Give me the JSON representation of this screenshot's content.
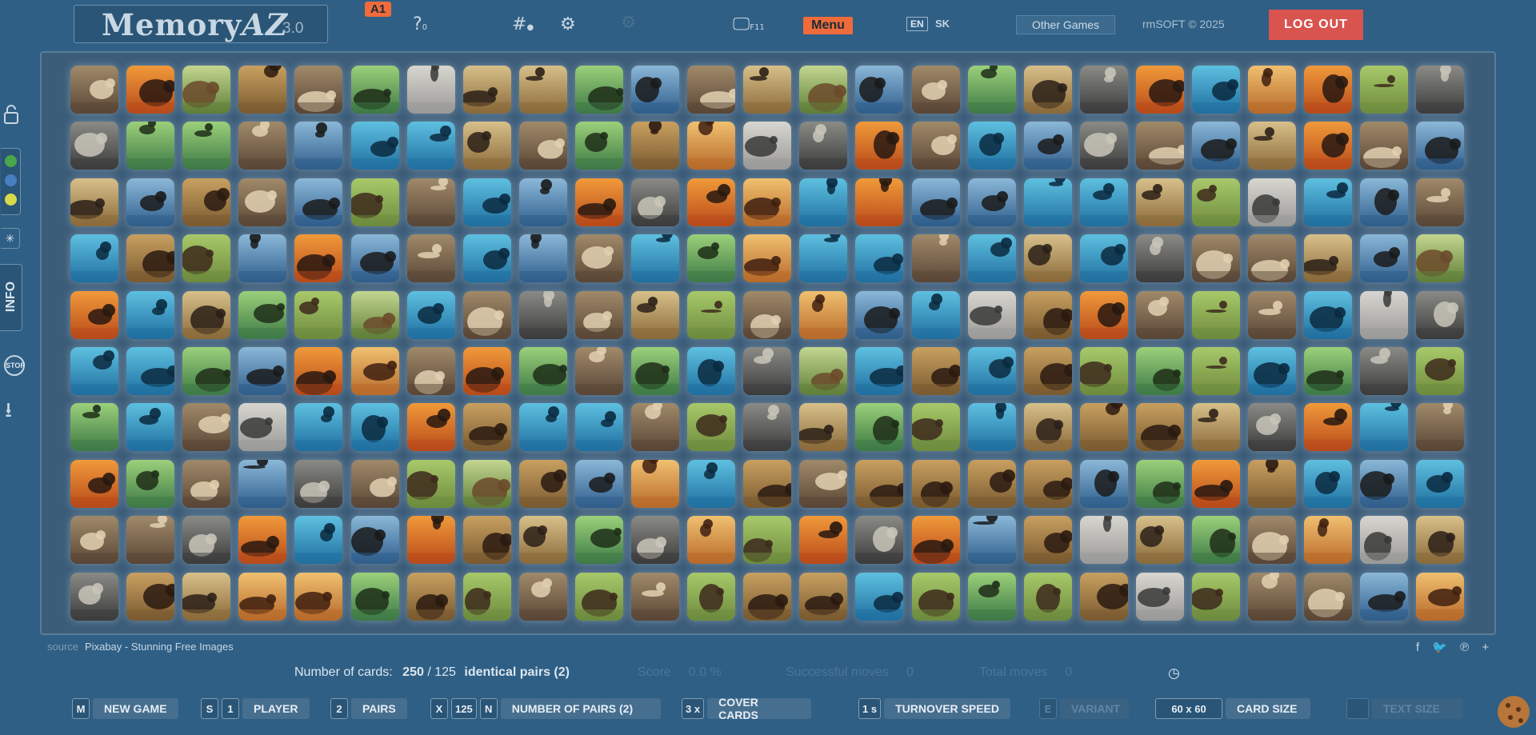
{
  "header": {
    "logo_name": "Memory",
    "logo_az": "AZ",
    "logo_version": "3.0",
    "level_badge": "A1",
    "help_icon": "?",
    "help_count": "0",
    "hash_icon": "#",
    "monitor_hint": "F11",
    "menu_label": "Menu",
    "lang_en": "EN",
    "lang_sk": "SK",
    "other_games": "Other Games",
    "copyright": "rmSOFT © 2025",
    "logout": "LOG OUT"
  },
  "sidebar": {
    "info_label": "INFO",
    "stop_label": "STOP",
    "colors": [
      "#4aa64a",
      "#4a7ec2",
      "#d8d84a"
    ]
  },
  "board": {
    "columns": 25,
    "rows": 10,
    "cards": [
      "shark",
      "orangutan",
      "butterfly",
      "cougar",
      "duck",
      "rooster",
      "peacock",
      "goose",
      "stag-beetle",
      "lion",
      "hamster",
      "tern",
      "stag-beetle",
      "lynx",
      "hamster",
      "lemur",
      "dragonfly",
      "porcupine",
      "meerkats",
      "orangutan",
      "camel",
      "iguana",
      "goat",
      "turtle",
      "salamander",
      "boar",
      "dragonfly",
      "pheasant",
      "elephant",
      "antelope",
      "peacock-butterfly",
      "parrot",
      "vulture",
      "emu",
      "snake",
      "hedgehog",
      "caterpillar",
      "chameleon",
      "chimpanzee",
      "goat",
      "shark",
      "skunk",
      "deer",
      "boar",
      "tern",
      "jellyfish",
      "squirrel",
      "yak",
      "duck",
      "cheetah",
      "snail",
      "deer",
      "crow",
      "leopard",
      "pig",
      "kangaroo",
      "clownfish",
      "peacock-butterfly",
      "antelope",
      "moose",
      "dolphin",
      "beetle",
      "macaw",
      "anteater",
      "polar-bear",
      "pig",
      "deer",
      "walrus",
      "rabbit",
      "angelfish",
      "spoonbill",
      "frog",
      "parrot",
      "ram",
      "cicada",
      "lizard",
      "mallard",
      "crab",
      "hornet",
      "tit",
      "jellyfish",
      "cicada",
      "camel",
      "hornet",
      "leopard",
      "walrus",
      "wildebeest",
      "horse",
      "walrus",
      "seahorse",
      "swallow",
      "hummingbird",
      "orca",
      "hippo",
      "chimpanzee",
      "mandrill",
      "duck",
      "goose",
      "deer",
      "butterfly",
      "fly",
      "pelican",
      "porcupine",
      "bear",
      "spoonbill",
      "fox",
      "gorilla",
      "mandrill",
      "salamander",
      "stingray",
      "angelfish",
      "turtle",
      "hen",
      "spider",
      "cheetah",
      "lemurs",
      "tapir",
      "hyena",
      "yak",
      "magpie",
      "turtle",
      "cicada",
      "grasshopper",
      "peacock",
      "panda",
      "hummingbird",
      "zebra",
      "lion",
      "hawks",
      "flamingo",
      "crane",
      "hen",
      "tit",
      "hare",
      "elephant",
      "guinea-pig",
      "koala",
      "pigeon",
      "fox",
      "zebra",
      "stork",
      "hippo",
      "mallard",
      "kangaroo",
      "dog",
      "turtle",
      "grasshopper",
      "rooster",
      "pigeon",
      "heron",
      "pheasant",
      "rabbit",
      "manatee",
      "chameleon",
      "turkey",
      "koala",
      "beetle",
      "sheep",
      "turkey",
      "pelican",
      "ladybugs",
      "heron",
      "meerkats",
      "goose",
      "owl",
      "fish",
      "anteater",
      "hawk",
      "cougar",
      "bison",
      "squirrel",
      "cat",
      "baboon",
      "walrus",
      "swallow",
      "fly",
      "snake",
      "stingray",
      "ostriches",
      "bats",
      "emu",
      "crab",
      "lynx",
      "crow",
      "deer",
      "caterpillar",
      "lemurs",
      "tiger",
      "manatee",
      "tiger",
      "cow",
      "crow",
      "stork",
      "ram",
      "dog",
      "moose",
      "hedgehog",
      "skunk",
      "wolf",
      "gorilla",
      "lemur",
      "clownfish",
      "dolphin",
      "moose",
      "lizard",
      "wolf",
      "polar-bear",
      "hyena",
      "vulture",
      "bear",
      "bats",
      "spider",
      "capercaillie",
      "baboon",
      "panda",
      "flamingo",
      "ostriches",
      "stag",
      "peacock",
      "orca",
      "owl",
      "mandrill",
      "iguana",
      "frog",
      "hawk",
      "cat",
      "penguins",
      "snail",
      "horse",
      "macaw",
      "guinea-pig",
      "cow",
      "raven",
      "magpie",
      "eagle",
      "cicada",
      "giraffe",
      "bison",
      "sheep",
      "seahorse",
      "eagle",
      "wildebeest",
      "giraffe",
      "penguins",
      "tapir",
      "fish",
      "ladybugs",
      "mandrill",
      "hawks",
      "crane"
    ]
  },
  "footer": {
    "source_label": "source",
    "source_name": "Pixabay - Stunning Free Images",
    "cards_label": "Number of cards:",
    "cards_count": "250",
    "pairs_text": "/ 125",
    "pairs_label": "identical pairs (2)",
    "score_label": "Score",
    "score_value": "0.0 %",
    "successful_label": "Successful moves",
    "successful_value": "0",
    "total_label": "Total moves",
    "total_value": "0"
  },
  "controls": {
    "new_game_key": "M",
    "new_game": "NEW GAME",
    "player_key": "S",
    "player_count": "1",
    "player": "PLAYER",
    "pairs_key": "2",
    "pairs": "PAIRS",
    "np_key_x": "X",
    "np_count": "125",
    "np_key_n": "N",
    "number_of_pairs": "NUMBER OF PAIRS (2)",
    "cover_count": "3 x",
    "cover_cards": "COVER CARDS",
    "speed_value": "1 s",
    "turnover_speed": "TURNOVER SPEED",
    "variant_key": "E",
    "variant": "VARIANT",
    "card_size_value": "60 x 60",
    "card_size": "CARD SIZE",
    "text_size": "TEXT SIZE"
  }
}
